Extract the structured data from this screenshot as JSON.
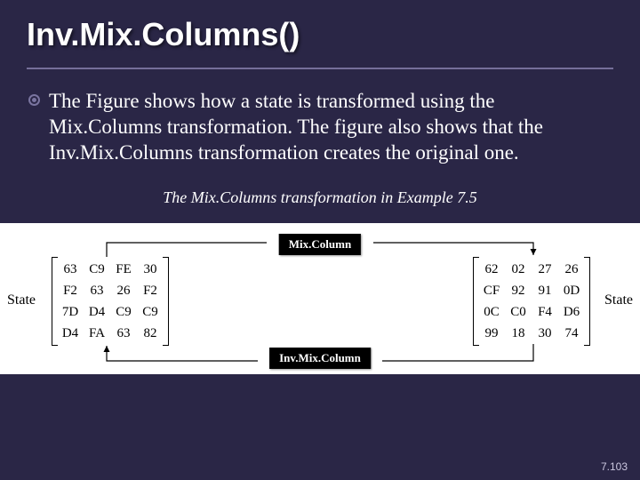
{
  "title": "Inv.Mix.Columns()",
  "paragraph": "The Figure shows how a state is transformed using the Mix.Columns transformation. The figure also shows that the Inv.Mix.Columns transformation creates the original one.",
  "caption": "The Mix.Columns transformation in Example 7.5",
  "figure": {
    "left_label": "State",
    "right_label": "State",
    "op_top": "Mix.Column",
    "op_bottom": "Inv.Mix.Column",
    "matrix_left": [
      [
        "63",
        "C9",
        "FE",
        "30"
      ],
      [
        "F2",
        "63",
        "26",
        "F2"
      ],
      [
        "7D",
        "D4",
        "C9",
        "C9"
      ],
      [
        "D4",
        "FA",
        "63",
        "82"
      ]
    ],
    "matrix_right": [
      [
        "62",
        "02",
        "27",
        "26"
      ],
      [
        "CF",
        "92",
        "91",
        "0D"
      ],
      [
        "0C",
        "C0",
        "F4",
        "D6"
      ],
      [
        "99",
        "18",
        "30",
        "74"
      ]
    ]
  },
  "page_number": "7.103"
}
